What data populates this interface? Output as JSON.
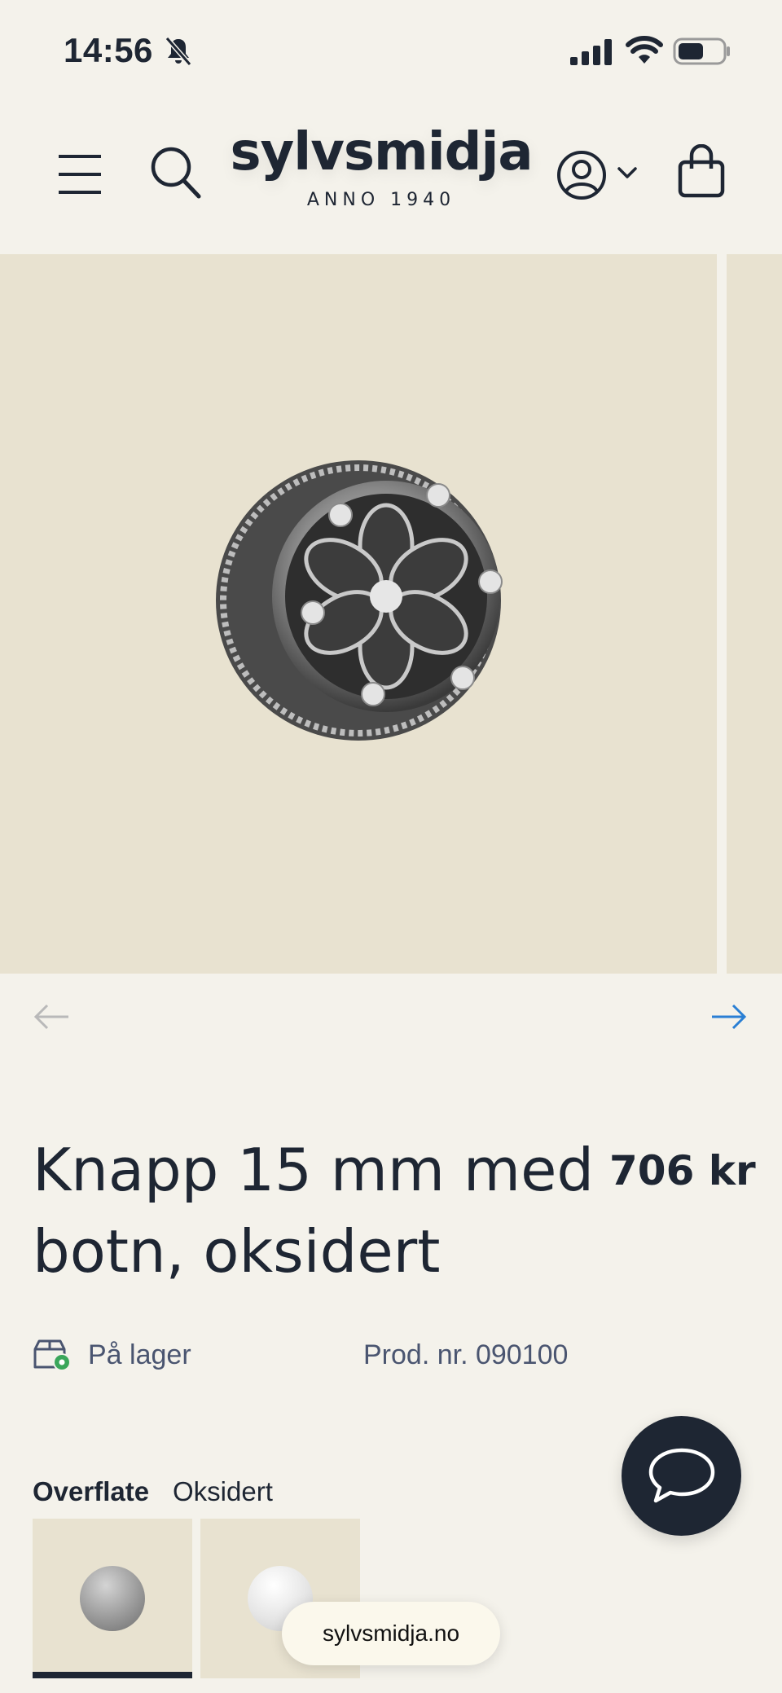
{
  "status_bar": {
    "time": "14:56"
  },
  "header": {
    "logo_name": "sylvsmidja",
    "logo_sub": "ANNO 1940",
    "icons": [
      "menu-icon",
      "search-icon",
      "account-icon",
      "chevron-down-icon",
      "bag-icon"
    ]
  },
  "gallery": {
    "image_icon": "filigree-button-image",
    "prev_icon": "arrow-left-icon",
    "next_icon": "arrow-right-icon"
  },
  "product": {
    "title": "Knapp 15 mm med botn, oksidert",
    "price": "706 kr",
    "stock": "På lager",
    "prod_nr": "Prod. nr. 090100"
  },
  "options": {
    "label": "Overflate",
    "value": "Oksidert"
  },
  "chat": {
    "icon": "chat-bubble-icon"
  },
  "browser": {
    "url": "sylvsmidja.no"
  },
  "colors": {
    "background": "#f4f2eb",
    "image_bg": "#e8e2d0",
    "text_dark": "#1e2633",
    "text_muted": "#4a5570",
    "accent_blue": "#2a7fd4",
    "stock_green": "#3aa65a"
  }
}
